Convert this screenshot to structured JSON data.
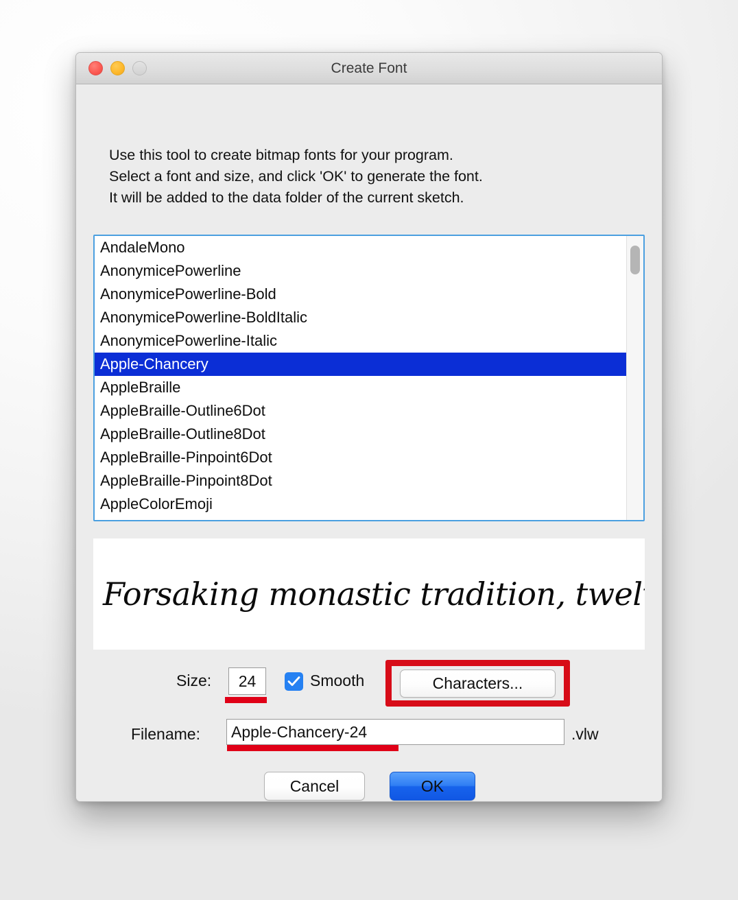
{
  "window": {
    "title": "Create Font",
    "traffic_lights": [
      {
        "name": "close",
        "color": "#fb5750"
      },
      {
        "name": "minimize",
        "color": "#fdb72a"
      },
      {
        "name": "zoom",
        "color": "#d2d2d2"
      }
    ]
  },
  "instructions": "Use this tool to create bitmap fonts for your program.\nSelect a font and size, and click 'OK' to generate the font.\nIt will be added to the data folder of the current sketch.",
  "font_list": {
    "selected": "Apple-Chancery",
    "items": [
      {
        "label": "AndaleMono",
        "selected": false
      },
      {
        "label": "AnonymicePowerline",
        "selected": false
      },
      {
        "label": "AnonymicePowerline-Bold",
        "selected": false
      },
      {
        "label": "AnonymicePowerline-BoldItalic",
        "selected": false
      },
      {
        "label": "AnonymicePowerline-Italic",
        "selected": false
      },
      {
        "label": "Apple-Chancery",
        "selected": true
      },
      {
        "label": "AppleBraille",
        "selected": false
      },
      {
        "label": "AppleBraille-Outline6Dot",
        "selected": false
      },
      {
        "label": "AppleBraille-Outline8Dot",
        "selected": false
      },
      {
        "label": "AppleBraille-Pinpoint6Dot",
        "selected": false
      },
      {
        "label": "AppleBraille-Pinpoint8Dot",
        "selected": false
      },
      {
        "label": "AppleColorEmoji",
        "selected": false
      }
    ],
    "selection_color": "#0b2ed6",
    "focus_border_color": "#4a9fe0"
  },
  "preview": {
    "sample_text": "Forsaking monastic tradition, twelve jov"
  },
  "size": {
    "label": "Size:",
    "value": "24"
  },
  "smooth": {
    "label": "Smooth",
    "checked": true,
    "checkbox_color": "#2681f2"
  },
  "characters": {
    "label": "Characters...",
    "highlight_color": "#d70c18"
  },
  "filename": {
    "label": "Filename:",
    "value": "Apple-Chancery-24",
    "extension": ".vlw",
    "underline_color": "#e00017"
  },
  "buttons": {
    "cancel": "Cancel",
    "ok": "OK",
    "ok_color": "#1763ec"
  }
}
